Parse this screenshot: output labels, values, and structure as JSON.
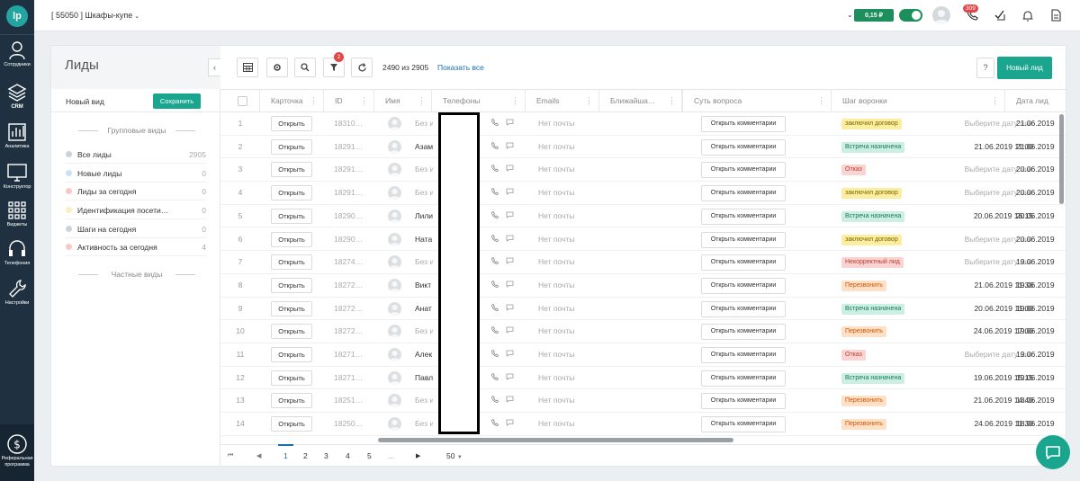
{
  "app": {
    "logo": "lp",
    "project": "[ 55050 ] Шкафы-купе",
    "balance": "0,15 ₽",
    "notifications_count": "309"
  },
  "rail": [
    {
      "label": "Сотрудники",
      "icon": "people-icon"
    },
    {
      "label": "CRM",
      "icon": "layers-icon"
    },
    {
      "label": "Аналитика",
      "icon": "chart-icon"
    },
    {
      "label": "Конструктор",
      "icon": "monitor-icon"
    },
    {
      "label": "Виджеты",
      "icon": "grid-icon"
    },
    {
      "label": "Телефония",
      "icon": "headset-icon"
    },
    {
      "label": "Настройки",
      "icon": "wrench-icon"
    },
    {
      "label_1": "Реферальная",
      "label_2": "программа",
      "icon": "dollar-icon"
    }
  ],
  "views": {
    "title": "Лиды",
    "new_view": "Новый вид",
    "save_label": "Сохранить",
    "group_title": "Групповые виды",
    "private_title": "Частные виды",
    "items": [
      {
        "name": "Все лиды",
        "count": "2905",
        "color": "#c9d3da"
      },
      {
        "name": "Новые лиды",
        "count": "0",
        "color": "#c7e3f3"
      },
      {
        "name": "Лиды за сегодня",
        "count": "0",
        "color": "#f6c9c6"
      },
      {
        "name": "Идентификация посети…",
        "count": "0",
        "color": "#f8f0c3"
      },
      {
        "name": "Шаги на сегодня",
        "count": "0",
        "color": "#c9d3da"
      },
      {
        "name": "Активность за сегодня",
        "count": "4",
        "color": "#f6c9c6"
      }
    ]
  },
  "toolbar": {
    "filter_badge": "2",
    "count_text": "2490 из 2905",
    "show_all": "Показать все",
    "help_label": "?",
    "new_lead_label": "Новый лид"
  },
  "columns": [
    "Карточка",
    "ID",
    "Имя",
    "Телефоны",
    "Emails",
    "Ближайша…",
    "Суть вопроса",
    "Шаг воронки",
    "Дата лид"
  ],
  "row_labels": {
    "open": "Открыть",
    "comment": "Открыть комментарии",
    "no_email": "Нет почты"
  },
  "rows": [
    {
      "n": "1",
      "id": "18310…",
      "name": "Без и",
      "step": "заключил договор",
      "step_color": "yellow",
      "date": "Выберите дату шаг",
      "date_set": false,
      "lead_date": "21.06.2019"
    },
    {
      "n": "2",
      "id": "18291…",
      "name": "Азам",
      "step": "Встреча назначена",
      "step_color": "green",
      "date": "21.06.2019 11:00",
      "date_set": true,
      "lead_date": "21.06.2019"
    },
    {
      "n": "3",
      "id": "18291…",
      "name": "Без и",
      "step": "Отказ",
      "step_color": "red",
      "date": "Выберите дату шаг",
      "date_set": false,
      "lead_date": "20.06.2019"
    },
    {
      "n": "4",
      "id": "18291…",
      "name": "Без и",
      "step": "заключил договор",
      "step_color": "yellow",
      "date": "Выберите дату шаг",
      "date_set": false,
      "lead_date": "20.06.2019"
    },
    {
      "n": "5",
      "id": "18290…",
      "name": "Лили",
      "step": "Встреча назначена",
      "step_color": "green",
      "date": "20.06.2019 16:15",
      "date_set": true,
      "lead_date": "20.06.2019"
    },
    {
      "n": "6",
      "id": "18290…",
      "name": "Ната",
      "step": "заключил договор",
      "step_color": "yellow",
      "date": "Выберите дату шаг",
      "date_set": false,
      "lead_date": "20.06.2019"
    },
    {
      "n": "7",
      "id": "18274…",
      "name": "Без и",
      "step": "Некорректный лид",
      "step_color": "red",
      "date": "Выберите дату шаг",
      "date_set": false,
      "lead_date": "19.06.2019"
    },
    {
      "n": "8",
      "id": "18272…",
      "name": "Викт",
      "step": "Перезвонить",
      "step_color": "orange",
      "date": "21.06.2019 11:38",
      "date_set": true,
      "lead_date": "19.06.2019"
    },
    {
      "n": "9",
      "id": "18272…",
      "name": "Анат",
      "step": "Встреча назначена",
      "step_color": "green",
      "date": "20.06.2019 11:00",
      "date_set": true,
      "lead_date": "19.06.2019"
    },
    {
      "n": "10",
      "id": "18272…",
      "name": "Без и",
      "step": "Перезвонить",
      "step_color": "orange",
      "date": "24.06.2019 17:00",
      "date_set": true,
      "lead_date": "19.06.2019"
    },
    {
      "n": "11",
      "id": "18271…",
      "name": "Алек",
      "step": "Отказ",
      "step_color": "red",
      "date": "Выберите дату шаг",
      "date_set": false,
      "lead_date": "19.06.2019"
    },
    {
      "n": "12",
      "id": "18271…",
      "name": "Павл",
      "step": "Встреча назначена",
      "step_color": "green",
      "date": "19.06.2019 15:15",
      "date_set": true,
      "lead_date": "19.06.2019"
    },
    {
      "n": "13",
      "id": "18251…",
      "name": "Без и",
      "step": "Перезвонить",
      "step_color": "orange",
      "date": "21.06.2019 14:40",
      "date_set": true,
      "lead_date": "18.06.2019"
    },
    {
      "n": "14",
      "id": "18250…",
      "name": "Без и",
      "step": "Перезвонить",
      "step_color": "orange",
      "date": "24.06.2019 11:30",
      "date_set": true,
      "lead_date": "18.06.2019"
    }
  ],
  "pager": {
    "pages": [
      "1",
      "2",
      "3",
      "4",
      "5",
      "..."
    ],
    "current": "1",
    "per_page": "50"
  },
  "colors": {
    "accent": "#1aa58f",
    "rail": "#1f3140",
    "balance": "#1d8f5c",
    "badge": "#e04848",
    "step_yellow_bg": "#fbeea0",
    "step_green_bg": "#cdeee2",
    "step_red_bg": "#fad4d2",
    "step_orange_bg": "#fde0c6"
  }
}
